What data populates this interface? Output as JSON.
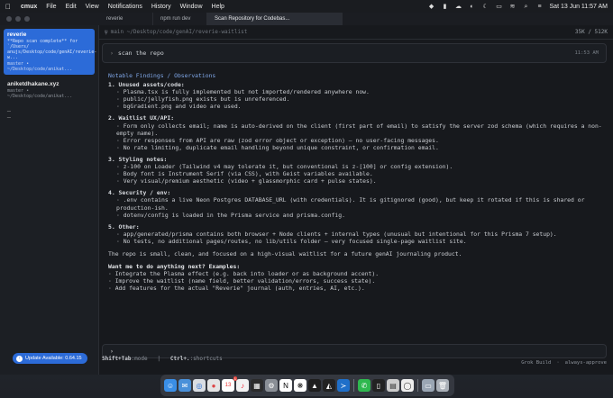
{
  "menubar": {
    "items": [
      "cmux",
      "File",
      "Edit",
      "View",
      "Notifications",
      "History",
      "Window",
      "Help"
    ],
    "clock": "Sat 13 Jun  11:57 AM"
  },
  "tabs": [
    "reverie",
    "npm run dev",
    "Scan Repository for Codebas..."
  ],
  "sidebar": {
    "workspaces": [
      {
        "title": "reverie",
        "notification": "**Repo scan complete** for `/Users/ anujs/Desktop/code/genAI/reverie-w...",
        "path": "master • ~/Desktop/code/anikat..."
      },
      {
        "title": "aniketdhakane.xyz",
        "notification": "",
        "path": "master • ~/Desktop/code/anikat..."
      }
    ],
    "update_label": "Update Available: 0.64.15"
  },
  "main": {
    "path": "main ~/Desktop/code/genAI/reverie-waitlist",
    "tokens": "35K / 512K",
    "prompt": "scan the repo",
    "prompt_time": "11:53 AM",
    "heading": "Notable Findings / Observations",
    "sections": [
      {
        "title": "1. Unused assets/code:",
        "bullets": [
          "· Plasma.tsx is fully implemented but not imported/rendered anywhere now.",
          "· public/jellyfish.png exists but is unreferenced.",
          "· bgGradient.png and video are used."
        ]
      },
      {
        "title": "2. Waitlist UX/API:",
        "bullets": [
          "· Form only collects email; name is auto-derived on the client (first part of email) to satisfy the server zod schema (which requires a non-empty name).",
          "· Error responses from API are raw (zod error object or exception) — no user-facing messages.",
          "· No rate limiting, duplicate email handling beyond unique constraint, or confirmation email."
        ]
      },
      {
        "title": "3. Styling notes:",
        "bullets": [
          "· z-100 on Loader (Tailwind v4 may tolerate it, but conventional is z-[100] or config extension).",
          "· Body font is Instrument Serif (via CSS), with Geist variables available.",
          "· Very visual/premium aesthetic (video + glassmorphic card + pulse states)."
        ]
      },
      {
        "title": "4. Security / env:",
        "bullets": [
          "· .env contains a live Neon Postgres DATABASE_URL (with credentials). It is gitignored (good), but keep it rotated if this is shared or production-ish.",
          "· dotenv/config is loaded in the Prisma service and prisma.config."
        ]
      },
      {
        "title": "5. Other:",
        "bullets": [
          "· app/generated/prisma contains both browser + Node clients + internal types (unusual but intentional for this Prisma 7 setup).",
          "· No tests, no additional pages/routes, no lib/utils folder — very focused single-page waitlist site."
        ]
      }
    ],
    "summary": "The repo is small, clean, and focused on a high-visual waitlist for a future genAI journaling product.",
    "question": "Want me to do anything next? Examples:",
    "options": [
      "· Integrate the Plasma effect (e.g. back into loader or as background accent).",
      "· Improve the waitlist (name field, better validation/errors, success state).",
      "· Add features for the actual \"Reverie\" journal (auth, entries, AI, etc.)."
    ],
    "input_caret": "›",
    "status_model": "Grok Build",
    "status_mode": "always-approve",
    "shortcut_key": "Shift+Tab",
    "shortcut_key_label": ":mode",
    "shortcut2_key": "Ctrl+.",
    "shortcut2_label": ":shortcuts"
  },
  "colors": {
    "accent": "#2c6bd8",
    "link": "#6f9be8"
  }
}
